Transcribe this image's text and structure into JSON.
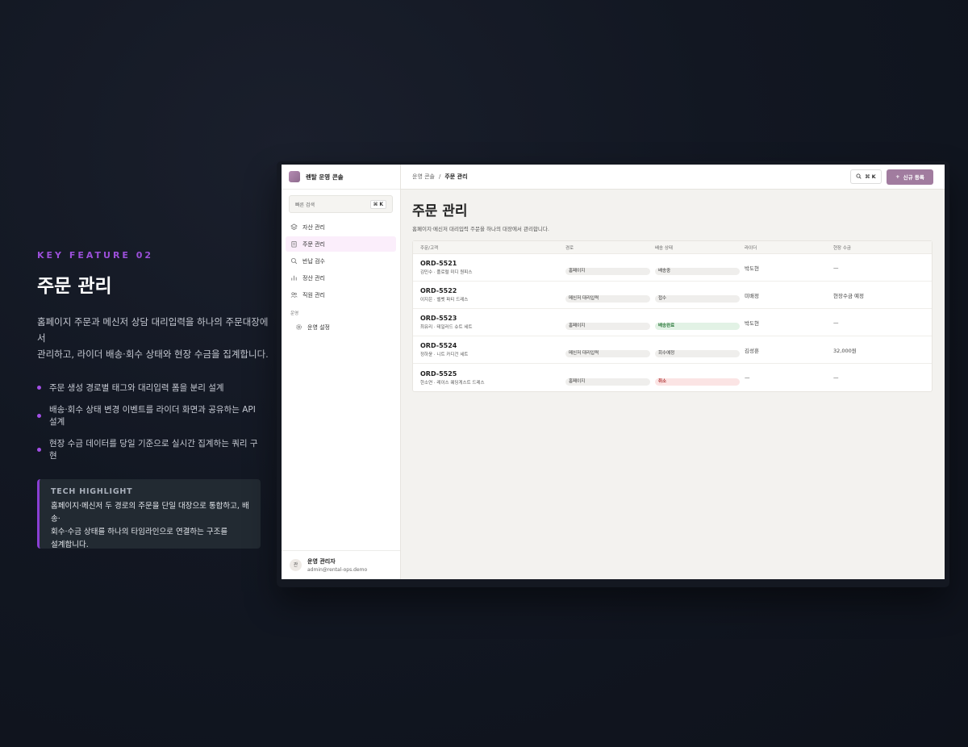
{
  "feature": {
    "kicker": "KEY FEATURE 02",
    "title": "주문 관리",
    "description_line1": "홈페이지 주문과 메신저 상담 대리입력을 하나의 주문대장에서",
    "description_line2": "관리하고, 라이더 배송·회수 상태와 현장 수금을 집계합니다.",
    "bullets": [
      "주문 생성 경로별 태그와 대리입력 폼을 분리 설계",
      "배송·회수 상태 변경 이벤트를 라이더 화면과 공유하는 API 설계",
      "현장 수금 데이터를 당일 기준으로 실시간 집계하는 쿼리 구현"
    ],
    "highlight": {
      "label": "TECH HIGHLIGHT",
      "line1": "홈페이지·메신저 두 경로의 주문을 단일 대장으로 통합하고, 배송·",
      "line2": "회수·수금 상태를 하나의 타임라인으로 연결하는 구조를",
      "line3": "설계합니다."
    }
  },
  "app": {
    "brand": "렌탈 운영 콘솔",
    "quick_search": {
      "label": "빠른 검색",
      "shortcut": "⌘ K"
    },
    "nav": [
      {
        "label": "자산 관리",
        "icon": "layers-icon"
      },
      {
        "label": "주문 관리",
        "icon": "clipboard-icon"
      },
      {
        "label": "반납 검수",
        "icon": "search-icon"
      },
      {
        "label": "정산 관리",
        "icon": "chart-icon"
      },
      {
        "label": "직원 관리",
        "icon": "users-icon"
      }
    ],
    "section_label": "운영",
    "settings_label": "운영 설정",
    "user": {
      "avatar": "관",
      "name": "운영 관리자",
      "email": "admin@rental-ops.demo"
    },
    "breadcrumb": {
      "root": "운영 콘솔",
      "separator": "/",
      "current": "주문 관리"
    },
    "search_shortcut": "⌘ K",
    "new_button": "신규 등록",
    "page_title": "주문 관리",
    "page_subtitle": "홈페이지·메신저 대리입력 주문을 하나의 대장에서 관리합니다.",
    "columns": [
      "주문/고객",
      "경로",
      "배송 상태",
      "라이더",
      "현장 수금"
    ],
    "orders": [
      {
        "id": "ORD-5521",
        "customer": "김민수 · 플로럴 미디 원피스",
        "channel": "홈페이지",
        "status": "배송중",
        "rider": "박도현",
        "payment": "—"
      },
      {
        "id": "ORD-5522",
        "customer": "이지은 · 벨벳 파티 드레스",
        "channel": "메신저 대리입력",
        "status": "접수",
        "rider": "미배정",
        "payment": "현장수금 예정"
      },
      {
        "id": "ORD-5523",
        "customer": "최유리 · 테일러드 슈트 세트",
        "channel": "홈페이지",
        "status": "배송완료",
        "rider": "박도현",
        "payment": "—"
      },
      {
        "id": "ORD-5524",
        "customer": "정하윤 · 니트 카디건 세트",
        "channel": "메신저 대리입력",
        "status": "회수예정",
        "rider": "김성훈",
        "payment": "32,000원"
      },
      {
        "id": "ORD-5525",
        "customer": "한소연 · 레이스 웨딩게스트 드레스",
        "channel": "홈페이지",
        "status": "취소",
        "rider": "—",
        "payment": "—"
      }
    ]
  },
  "colors": {
    "accent_purple": "#9b4fd9",
    "button_mauve": "#a17c9f",
    "status_done": "#2f7a3e",
    "status_cancel": "#b43a3a"
  }
}
